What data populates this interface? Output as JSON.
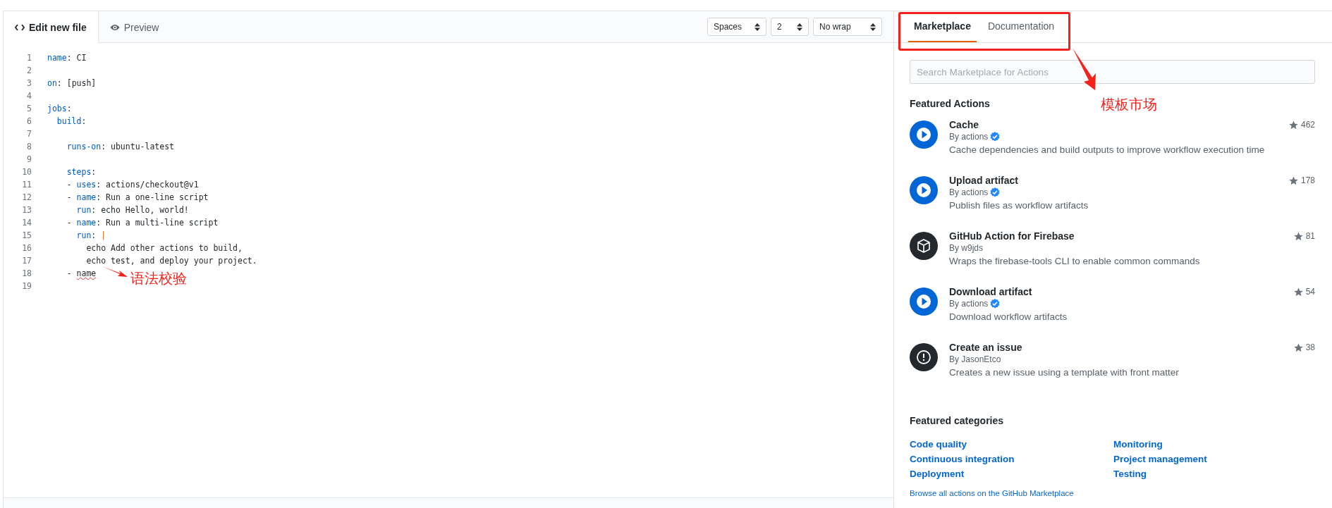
{
  "editor": {
    "tabs": [
      {
        "label": "Edit new file",
        "kind": "code",
        "selected": true
      },
      {
        "label": "Preview",
        "kind": "eye",
        "selected": false
      }
    ],
    "selects": [
      {
        "value": "Spaces"
      },
      {
        "value": "2"
      },
      {
        "value": "No wrap"
      }
    ],
    "lines": [
      {
        "number": "1",
        "parts": [
          {
            "kind": "key",
            "text": "name"
          },
          {
            "kind": "plain",
            "text": ": CI"
          }
        ]
      },
      {
        "number": "2"
      },
      {
        "number": "3",
        "parts": [
          {
            "kind": "key",
            "text": "on"
          },
          {
            "kind": "plain",
            "text": ": [push]"
          }
        ]
      },
      {
        "number": "4"
      },
      {
        "number": "5",
        "parts": [
          {
            "kind": "key",
            "text": "jobs"
          },
          {
            "kind": "plain",
            "text": ":"
          }
        ]
      },
      {
        "number": "6",
        "parts": [
          {
            "kind": "key",
            "text": "  build"
          },
          {
            "kind": "plain",
            "text": ":"
          }
        ]
      },
      {
        "number": "7"
      },
      {
        "number": "8",
        "parts": [
          {
            "kind": "key",
            "text": "    runs-on"
          },
          {
            "kind": "plain",
            "text": ": ubuntu-latest"
          }
        ]
      },
      {
        "number": "9"
      },
      {
        "number": "10",
        "parts": [
          {
            "kind": "key",
            "text": "    steps"
          },
          {
            "kind": "plain",
            "text": ":"
          }
        ]
      },
      {
        "number": "11",
        "parts": [
          {
            "kind": "plain",
            "text": "    - "
          },
          {
            "kind": "key",
            "text": "uses"
          },
          {
            "kind": "plain",
            "text": ": actions/checkout@v1"
          }
        ]
      },
      {
        "number": "12",
        "parts": [
          {
            "kind": "plain",
            "text": "    - "
          },
          {
            "kind": "key",
            "text": "name"
          },
          {
            "kind": "plain",
            "text": ": Run a one-line script"
          }
        ]
      },
      {
        "number": "13",
        "parts": [
          {
            "kind": "key",
            "text": "      run"
          },
          {
            "kind": "plain",
            "text": ": echo Hello, world!"
          }
        ]
      },
      {
        "number": "14",
        "parts": [
          {
            "kind": "plain",
            "text": "    - "
          },
          {
            "kind": "key",
            "text": "name"
          },
          {
            "kind": "plain",
            "text": ": Run a multi-line script"
          }
        ]
      },
      {
        "number": "15",
        "parts": [
          {
            "kind": "key",
            "text": "      run"
          },
          {
            "kind": "plain",
            "text": ": "
          },
          {
            "kind": "operator",
            "text": "|"
          }
        ]
      },
      {
        "number": "16",
        "parts": [
          {
            "kind": "plain",
            "text": "        echo Add other actions to build,"
          }
        ]
      },
      {
        "number": "17",
        "parts": [
          {
            "kind": "plain",
            "text": "        echo test, and deploy your project."
          }
        ]
      },
      {
        "number": "18",
        "parts": [
          {
            "kind": "plain",
            "text": "    - "
          },
          {
            "kind": "error",
            "text": "name"
          }
        ]
      },
      {
        "number": "19"
      }
    ]
  },
  "annotations": [
    {
      "text": "语法校验"
    },
    {
      "text": "模板市场"
    }
  ],
  "sidebar": {
    "tabs": [
      {
        "label": "Marketplace",
        "selected": true
      },
      {
        "label": "Documentation",
        "selected": false
      }
    ],
    "search": {
      "placeholder": "Search Marketplace for Actions"
    },
    "featured_title": "Featured Actions",
    "actions": [
      {
        "title": "Cache",
        "author": "By actions",
        "verified": true,
        "kind": "play",
        "stars": "462",
        "description": "Cache dependencies and build outputs to improve workflow execution time"
      },
      {
        "title": "Upload artifact",
        "author": "By actions",
        "verified": true,
        "kind": "play",
        "stars": "178",
        "description": "Publish files as workflow artifacts"
      },
      {
        "title": "GitHub Action for Firebase",
        "author": "By w9jds",
        "verified": false,
        "kind": "box",
        "stars": "81",
        "description": "Wraps the firebase-tools CLI to enable common commands"
      },
      {
        "title": "Download artifact",
        "author": "By actions",
        "verified": true,
        "kind": "play",
        "stars": "54",
        "description": "Download workflow artifacts"
      },
      {
        "title": "Create an issue",
        "author": "By JasonEtco",
        "verified": false,
        "kind": "alert",
        "stars": "38",
        "description": "Creates a new issue using a template with front matter"
      }
    ],
    "categories_title": "Featured categories",
    "categories": [
      "Code quality",
      "Monitoring",
      "Continuous integration",
      "Project management",
      "Deployment",
      "Testing"
    ],
    "browse_link": "Browse all actions on the GitHub Marketplace"
  }
}
